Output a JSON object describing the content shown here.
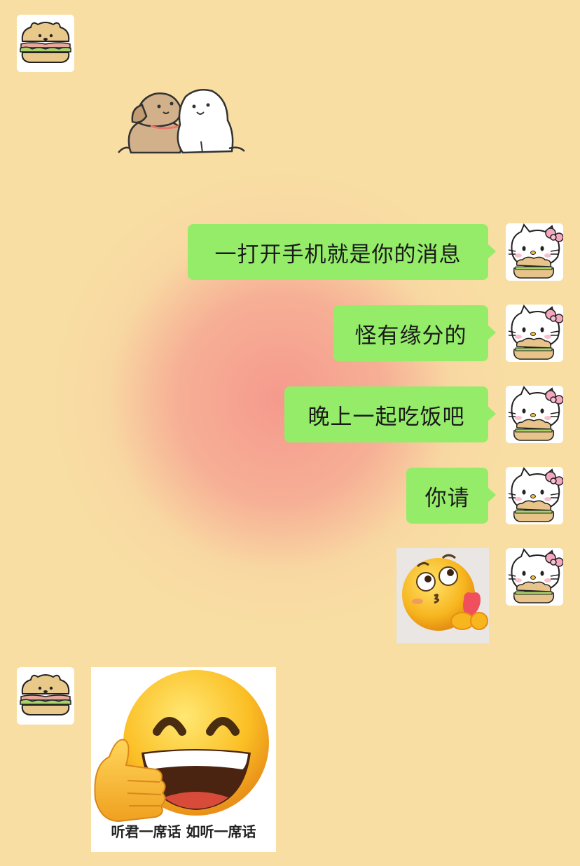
{
  "chat": {
    "messages": [
      {
        "sender": "other",
        "type": "sticker",
        "sticker": "two-puppies"
      },
      {
        "sender": "me",
        "type": "text",
        "text": "一打开手机就是你的消息"
      },
      {
        "sender": "me",
        "type": "text",
        "text": "怪有缘分的"
      },
      {
        "sender": "me",
        "type": "text",
        "text": "晚上一起吃饭吧"
      },
      {
        "sender": "me",
        "type": "text",
        "text": "你请"
      },
      {
        "sender": "me",
        "type": "sticker",
        "sticker": "blushing-emoji-with-heart"
      },
      {
        "sender": "other",
        "type": "sticker",
        "sticker": "grinning-thumbs-up-emoji",
        "caption": "听君一席话 如听一席话"
      }
    ]
  },
  "avatars": {
    "other": "bear-sandwich-avatar",
    "me": "hello-kitty-avatar"
  },
  "colors": {
    "background": "#f8dea3",
    "glow": "#f5968c",
    "bubble_green": "#95ec69"
  }
}
